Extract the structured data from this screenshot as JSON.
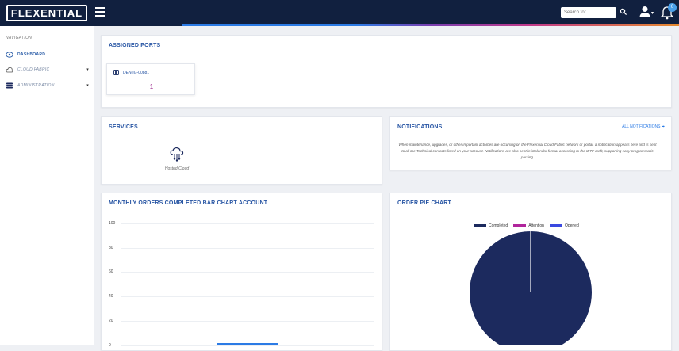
{
  "header": {
    "logo": "FLEXENTIAL",
    "search_placeholder": "Search for...",
    "notification_count": "0"
  },
  "sidebar": {
    "section_label": "NAVIGATION",
    "items": [
      {
        "label": "DASHBOARD",
        "icon": "dashboard-icon"
      },
      {
        "label": "CLOUD FABRIC",
        "icon": "cloud-icon"
      },
      {
        "label": "ADMINISTRATION",
        "icon": "database-icon"
      }
    ]
  },
  "assigned_ports": {
    "title": "ASSIGNED PORTS",
    "ports": [
      {
        "name": "DEN-IG-00881",
        "count": "1"
      }
    ]
  },
  "services": {
    "title": "SERVICES",
    "items": [
      {
        "label": "Hosted Cloud",
        "icon": "hosted-cloud-icon"
      }
    ]
  },
  "notifications": {
    "title": "NOTIFICATIONS",
    "link": "ALL NOTIFICATIONS ➡",
    "text": "When maintenance, upgrades, or other important activities are occurring on the Flexential Cloud Fabric network or portal, a notification appears here and is sent to all the Technical contacts listed on your account. Notifications are also sent in iCalendar format according to the IETF draft, supporting easy programmatic parsing."
  },
  "chart_data": [
    {
      "type": "bar",
      "title": "MONTHLY ORDERS COMPLETED BAR CHART ACCOUNT",
      "ylim": [
        0,
        100
      ],
      "yticks": [
        "100",
        "80",
        "60",
        "40",
        "20",
        "0"
      ],
      "grid": true
    },
    {
      "type": "pie",
      "title": "ORDER PIE CHART",
      "legend_position": "top",
      "series": [
        {
          "name": "Completed",
          "value": 100,
          "color": "#1c2a5e"
        },
        {
          "name": "Attention",
          "value": 0,
          "color": "#b1259c"
        },
        {
          "name": "Opened",
          "value": 0,
          "color": "#3a49e0"
        }
      ]
    }
  ]
}
